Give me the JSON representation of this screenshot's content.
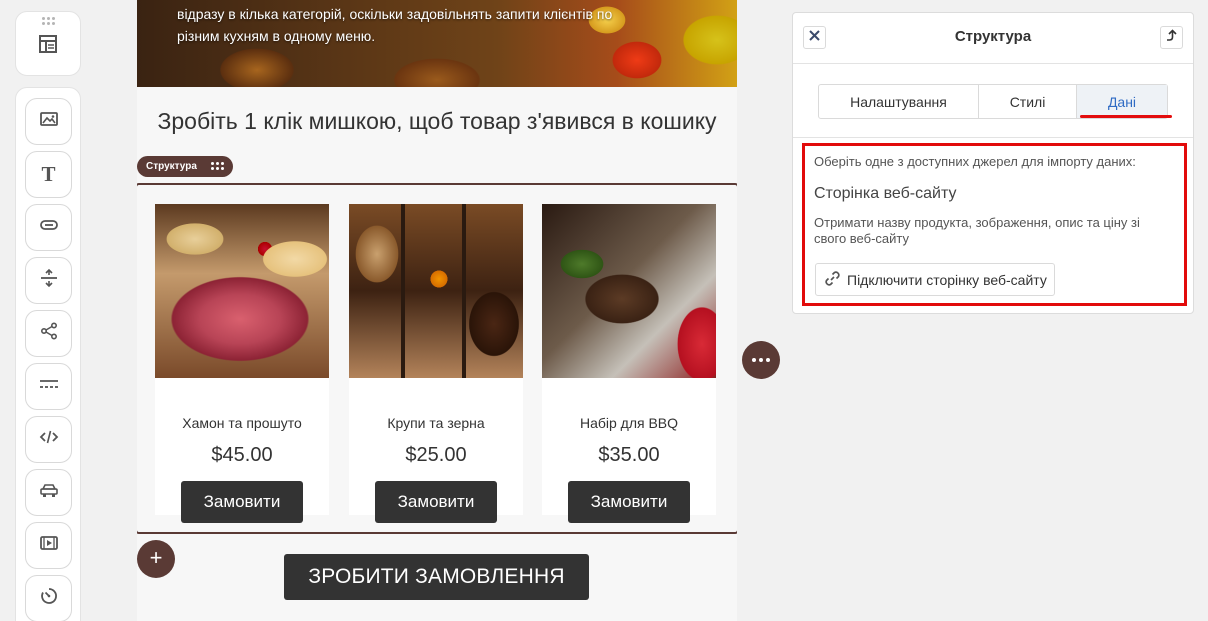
{
  "canvas": {
    "hero_text_line1": "відразу в кілька категорій, оскільки задовільнять запити клієнтів по",
    "hero_text_line2": "різним кухням в одному меню.",
    "section_title": "Зробіть 1 клік мишкою, щоб товар з'явився в кошику",
    "structure_tag": "Структура",
    "products": [
      {
        "name": "Хамон та прошуто",
        "price": "$45.00",
        "button": "Замовити"
      },
      {
        "name": "Крупи та зерна",
        "price": "$25.00",
        "button": "Замовити"
      },
      {
        "name": "Набір для BBQ",
        "price": "$35.00",
        "button": "Замовити"
      }
    ],
    "order_button": "ЗРОБИТИ ЗАМОВЛЕННЯ",
    "add_button": "+"
  },
  "toolbar": {
    "icons": [
      "layout-icon",
      "image-icon",
      "text-icon",
      "button-icon",
      "spacer-icon",
      "social-icon",
      "divider-icon",
      "code-icon",
      "car-icon",
      "video-icon",
      "timer-icon"
    ],
    "text_glyph": "T"
  },
  "panel": {
    "title": "Структура",
    "tabs": [
      "Налаштування",
      "Стилі",
      "Дані"
    ],
    "active_tab": "Дані",
    "intro": "Оберіть одне з доступних джерел для імпорту даних:",
    "source_title": "Сторінка веб-сайту",
    "source_desc": "Отримати назву продукта, зображення, опис та ціну зі свого веб-сайту",
    "connect_button": "Підключити сторінку веб-сайту"
  },
  "colors": {
    "accent_dark": "#5a3a35",
    "highlight_red": "#e20b0b",
    "active_tab_blue": "#2f6bc4",
    "button_dark": "#333333"
  }
}
